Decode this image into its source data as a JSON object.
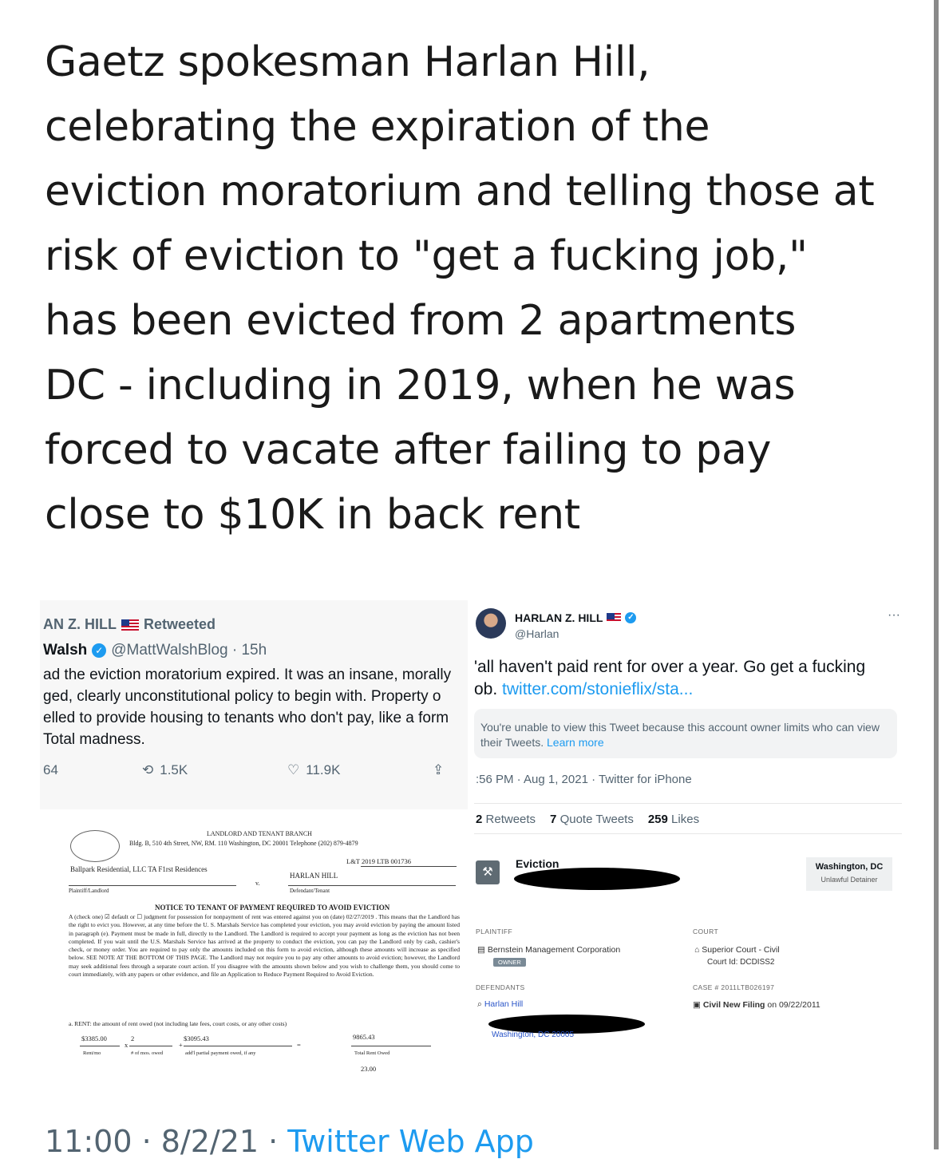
{
  "headline": {
    "lines": [
      "Gaetz spokesman Harlan Hill,",
      "celebrating the expiration of the",
      "eviction moratorium and telling those at",
      "risk of eviction to \"get a fucking job,\"",
      "has been evicted from 2 apartments",
      "DC - including in 2019, when he was",
      "forced to vacate after failing to pay",
      "close to $10K in back rent"
    ]
  },
  "left_tweet": {
    "retweeted_by": "AN Z. HILL",
    "retweeted_label": "Retweeted",
    "author_name": "Walsh",
    "author_handle": "@MattWalshBlog · 15h",
    "body_lines": [
      "ad the eviction moratorium expired. It was an insane, morally",
      "ged, clearly unconstitutional policy to begin with. Property o",
      "elled to provide housing to tenants who don't pay, like a form",
      " Total madness."
    ],
    "replies": "64",
    "retweets": "1.5K",
    "likes": "11.9K"
  },
  "court_form": {
    "branch": "LANDLORD AND TENANT BRANCH",
    "address": "Bldg. B, 510 4th Street, NW, RM. 110 Washington, DC 20001 Telephone (202) 879-4879",
    "case_prefix": "L&T",
    "case_number": "2019 LTB 001736",
    "plaintiff": "Ballpark Residential, LLC TA F1rst Residences",
    "defendant": "HARLAN HILL",
    "versus": "v.",
    "plaintiff_label": "Plaintiff/Landlord",
    "defendant_label": "Defendant/Tenant",
    "title": "NOTICE TO TENANT OF PAYMENT REQUIRED TO AVOID EVICTION",
    "paragraph": "A (check one) ☑ default or ☐ judgment for possession for nonpayment of rent was entered against you on (date) 02/27/2019 . This means that the Landlord has the right to evict you. However, at any time before the U. S. Marshals Service has completed your eviction, you may avoid eviction by paying the amount listed in paragraph (e). Payment must be made in full, directly to the Landlord. The Landlord is required to accept your payment as long as the eviction has not been completed. If you wait until the U.S. Marshals Service has arrived at the property to conduct the eviction, you can pay the Landlord only by cash, cashier's check, or money order. You are required to pay only the amounts included on this form to avoid eviction, although these amounts will increase as specified below. SEE NOTE AT THE BOTTOM OF THIS PAGE. The Landlord may not require you to pay any other amounts to avoid eviction; however, the Landlord may seek additional fees through a separate court action. If you disagree with the amounts shown below and you wish to challenge them, you should come to court immediately, with any papers or other evidence, and file an Application to Reduce Payment Required to Avoid Eviction.",
    "rent_heading": "a.  RENT: the amount of rent owed (not including late fees, court costs, or any other costs)",
    "rent_per_month": "$3385.00",
    "months_owed": "2",
    "partial_payment": "$3095.43",
    "total_rent_owed": "9865.43",
    "label_rent_mo": "Rent/mo",
    "label_months": "# of mos. owed",
    "label_partial": "add'l partial payment owed, if any",
    "label_total": "Total Rent Owed",
    "next_value": "23.00",
    "x_sym": "x",
    "plus_sym": "+",
    "eq_sym": "="
  },
  "right_tweet": {
    "name": "HARLAN Z. HILL",
    "handle": "@Harlan",
    "more": "···",
    "text_line1": "'all haven't paid rent for over a year. Go get a fucking",
    "text_line2_prefix": "ob. ",
    "text_link": "twitter.com/stonieflix/sta...",
    "notice": "You're unable to view this Tweet because this account owner limits who can view their Tweets.",
    "learn_more": "Learn more",
    "timestamp": ":56 PM · Aug 1, 2021 · Twitter for iPhone",
    "retweets_count": "2",
    "retweets_label": "Retweets",
    "quotes_count": "7",
    "quotes_label": "Quote Tweets",
    "likes_count": "259",
    "likes_label": "Likes"
  },
  "eviction_record": {
    "title": "Eviction",
    "location": "Washington, DC",
    "type": "Unlawful Detainer",
    "plaintiff_label": "PLAINTIFF",
    "plaintiff": "Bernstein Management Corporation",
    "owner_badge": "OWNER",
    "court_label": "COURT",
    "court": "Superior Court - Civil",
    "court_id": "Court Id: DCDISS2",
    "defendants_label": "DEFENDANTS",
    "defendant": "Harlan Hill",
    "defendant_city": "Washington, DC 20005",
    "case_label": "CASE # 2011LTB026197",
    "filing_label": "Civil New Filing",
    "filing_date": "on 09/22/2011"
  },
  "footer": {
    "time": "11:00 · 8/2/21 · ",
    "app": "Twitter Web App"
  }
}
